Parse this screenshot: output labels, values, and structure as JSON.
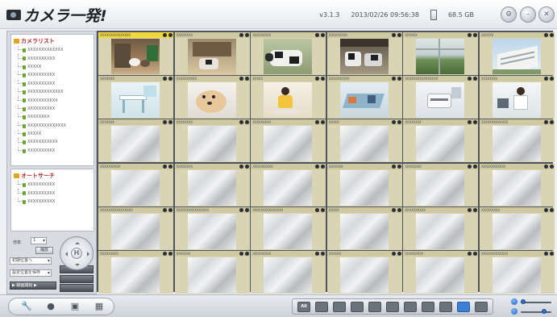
{
  "app": {
    "title": "カメラ一発!",
    "version": "v3.1.3",
    "datetime": "2013/02/26 09:56:38",
    "disk_free": "68.5 GB"
  },
  "window_buttons": [
    "settings-icon",
    "minimize-icon",
    "close-icon"
  ],
  "left_panel": {
    "camera_list": {
      "title": "カメラリスト",
      "items": [
        "XXXXXXXXXXXXX",
        "XXXXXXXXXX",
        "XXXXX",
        "XXXXXXXXXX",
        "XXXXXXXXXX",
        "XXXXXXXXXXXXX",
        "XXXXXXXXXXX",
        "XXXXXXXXXX",
        "XXXXXXXX",
        "XXXXXXXXXXXXXX",
        "XXXXX",
        "XXXXXXXXXXX",
        "XXXXXXXXXX"
      ]
    },
    "auto_search": {
      "title": "オートサーチ",
      "items": [
        "XXXXXXXXXX",
        "XXXXXXXXXX",
        "XXXXXXXXXX"
      ]
    },
    "controls": {
      "zoom_label": "倍率",
      "zoom_value": "1",
      "zoom_btn": "縮放",
      "preset_select": "初期位置へ",
      "preset_btn": "",
      "save_select": "設定位置を保存",
      "record_label": "▶ 録画開始 ▶"
    }
  },
  "grid": {
    "rows": 6,
    "cols": 6,
    "cells": [
      {
        "title": "XXXXXXXXXXXXXXX",
        "scene": "rabbits",
        "selected": true
      },
      {
        "title": "XXXXXXXX",
        "scene": "cow-stall"
      },
      {
        "title": "XXXXXXXXX",
        "scene": "cow"
      },
      {
        "title": "XXXXXXXXX",
        "scene": "cows-barn"
      },
      {
        "title": "XXXXXX",
        "scene": "greenhouse"
      },
      {
        "title": "XXXXXX",
        "scene": "building"
      },
      {
        "title": "XXXXXXX",
        "scene": "kitchen"
      },
      {
        "title": "XXXXXXXXXX",
        "scene": "puppy"
      },
      {
        "title": "XXXXX",
        "scene": "girl"
      },
      {
        "title": "XXXXXXXXXX",
        "scene": "office-room"
      },
      {
        "title": "XXXXXXXXXXXXXXXX",
        "scene": "office-printer"
      },
      {
        "title": "XXXXXXXX",
        "scene": "office-woman"
      },
      {
        "title": "XXXXXXX",
        "scene": "none"
      },
      {
        "title": "XXXXXXXX",
        "scene": "none"
      },
      {
        "title": "XXXXXXXXX",
        "scene": "none"
      },
      {
        "title": "XXXXX",
        "scene": "none"
      },
      {
        "title": "XXXXXXXX",
        "scene": "none"
      },
      {
        "title": "XXXXXXXXXXXXX",
        "scene": "none"
      },
      {
        "title": "XXXXXXXXXX",
        "scene": "none"
      },
      {
        "title": "XXXXXXXX",
        "scene": "none"
      },
      {
        "title": "XXXXXXXXXX",
        "scene": "none"
      },
      {
        "title": "XXXXXXX",
        "scene": "none"
      },
      {
        "title": "XXXXXXXX",
        "scene": "none"
      },
      {
        "title": "XXXXXXXXXXXX",
        "scene": "none"
      },
      {
        "title": "XXXXXXXXXXXXXXXX",
        "scene": "none"
      },
      {
        "title": "XXXXXXXXXXXXXXXX",
        "scene": "none"
      },
      {
        "title": "XXXXXXXXXXXXXXX",
        "scene": "none"
      },
      {
        "title": "XXXXX",
        "scene": "none"
      },
      {
        "title": "XXXXXXXXXX",
        "scene": "none"
      },
      {
        "title": "XXXXXXXXX",
        "scene": "none"
      },
      {
        "title": "XXXXXXXXX",
        "scene": "none"
      },
      {
        "title": "XXXXXXX",
        "scene": "none"
      },
      {
        "title": "XXXXXXXXX",
        "scene": "none"
      },
      {
        "title": "XXXXXX",
        "scene": "none"
      },
      {
        "title": "XXXXXXXXX",
        "scene": "none"
      },
      {
        "title": "XXXXXXXXXXXXX",
        "scene": "none"
      }
    ]
  },
  "bottom": {
    "tools": [
      "tools-icon",
      "record-icon",
      "snapshot-icon",
      "grid-settings-icon"
    ],
    "layouts": [
      {
        "label": "All",
        "active": false
      },
      {
        "label": "",
        "active": false
      },
      {
        "label": "",
        "active": false
      },
      {
        "label": "",
        "active": false
      },
      {
        "label": "",
        "active": false
      },
      {
        "label": "",
        "active": false
      },
      {
        "label": "",
        "active": false
      },
      {
        "label": "",
        "active": false
      },
      {
        "label": "",
        "active": false
      },
      {
        "label": "",
        "active": true
      },
      {
        "label": "",
        "active": false
      }
    ]
  },
  "colors": {
    "selected_header": "#f2d73a",
    "cell_header": "#cfc9a2",
    "accent_blue": "#3a7fd5",
    "tree_title": "#b4282e"
  }
}
